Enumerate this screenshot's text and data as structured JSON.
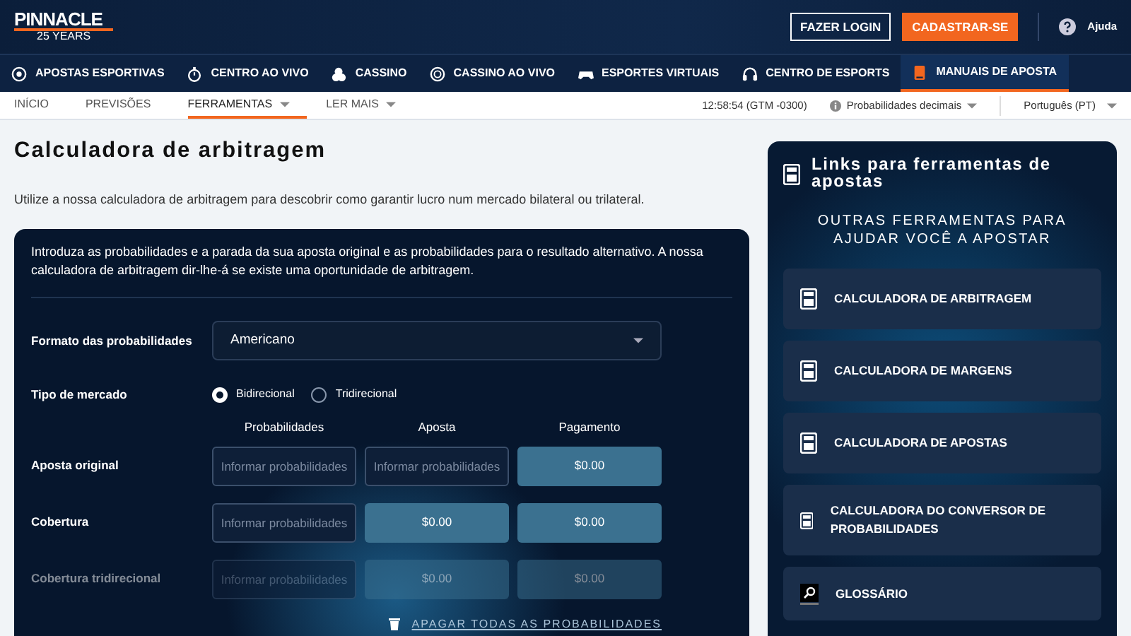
{
  "header": {
    "logo": "PINNACLE",
    "logo_sub": "25 YEARS",
    "login": "FAZER LOGIN",
    "signup": "CADASTRAR-SE",
    "help": "Ajuda"
  },
  "main_nav": [
    {
      "label": "APOSTAS ESPORTIVAS",
      "kind": "ball",
      "selected": false
    },
    {
      "label": "CENTRO AO VIVO",
      "kind": "live",
      "selected": false
    },
    {
      "label": "CASSINO",
      "kind": "chips",
      "selected": false
    },
    {
      "label": "CASSINO AO VIVO",
      "kind": "roulette",
      "selected": false
    },
    {
      "label": "ESPORTES VIRTUAIS",
      "kind": "virtual",
      "selected": false
    },
    {
      "label": "CENTRO DE ESPORTS",
      "kind": "headset",
      "selected": false
    },
    {
      "label": "MANUAIS DE APOSTA",
      "kind": "book",
      "selected": true
    }
  ],
  "sub_nav": [
    {
      "label": "INÍCIO",
      "dropdown": false,
      "selected": false
    },
    {
      "label": "PREVISÕES",
      "dropdown": false,
      "selected": false
    },
    {
      "label": "FERRAMENTAS",
      "dropdown": true,
      "selected": true
    },
    {
      "label": "LER MAIS",
      "dropdown": true,
      "selected": false
    }
  ],
  "sub_nav_right": {
    "time": "12:58:54 (GTM -0300)",
    "odds_format": "Probabilidades decimais",
    "language": "Português (PT)"
  },
  "page": {
    "title": "Calculadora de arbitragem",
    "description": "Utilize a nossa calculadora de arbitragem para descobrir como garantir lucro num mercado bilateral ou trilateral."
  },
  "calculator": {
    "intro": "Introduza as probabilidades e a parada da sua aposta original e as probabilidades para o resultado alternativo. A nossa calculadora de arbitragem dir-lhe-á se existe uma oportunidade de arbitragem.",
    "format_label": "Formato das probabilidades",
    "format_value": "Americano",
    "market_label": "Tipo de mercado",
    "market_options": [
      {
        "label": "Bidirecional",
        "selected": true
      },
      {
        "label": "Tridirecional",
        "selected": false
      }
    ],
    "columns": [
      "Probabilidades",
      "Aposta",
      "Pagamento"
    ],
    "rows": [
      {
        "label": "Aposta original",
        "disabled": false,
        "cells": [
          {
            "kind": "input",
            "placeholder": "Informar probabilidades"
          },
          {
            "kind": "input",
            "placeholder": "Informar probabilidades"
          },
          {
            "kind": "output",
            "value": "$0.00"
          }
        ]
      },
      {
        "label": "Cobertura",
        "disabled": false,
        "cells": [
          {
            "kind": "input",
            "placeholder": "Informar probabilidades"
          },
          {
            "kind": "output",
            "value": "$0.00"
          },
          {
            "kind": "output",
            "value": "$0.00"
          }
        ]
      },
      {
        "label": "Cobertura tridirecional",
        "disabled": true,
        "cells": [
          {
            "kind": "input",
            "placeholder": "Informar probabilidades"
          },
          {
            "kind": "output",
            "value": "$0.00"
          },
          {
            "kind": "output",
            "value": "$0.00"
          }
        ]
      }
    ],
    "clear_link": "APAGAR TODAS AS PROBABILIDADES"
  },
  "sidebar": {
    "title": "Links para ferramentas de apostas",
    "subtitle": "OUTRAS FERRAMENTAS PARA AJUDAR VOCÊ A APOSTAR",
    "links": [
      {
        "label": "CALCULADORA DE ARBITRAGEM",
        "kind": "calculator"
      },
      {
        "label": "CALCULADORA DE MARGENS",
        "kind": "calculator"
      },
      {
        "label": "CALCULADORA DE APOSTAS",
        "kind": "calculator"
      },
      {
        "label": "CALCULADORA DO CONVERSOR DE PROBABILIDADES",
        "kind": "calculator"
      },
      {
        "label": "GLOSSÁRIO",
        "kind": "glossary"
      }
    ]
  }
}
